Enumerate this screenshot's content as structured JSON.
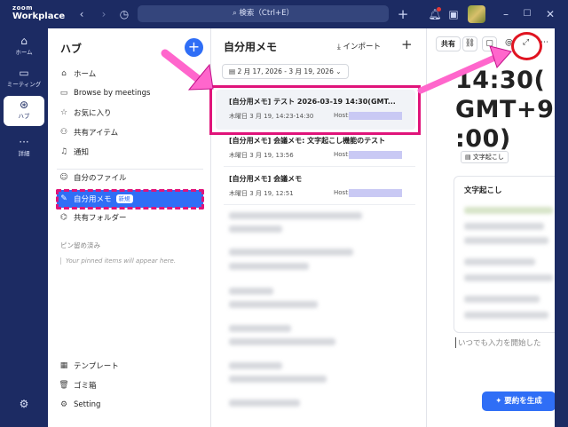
{
  "app": {
    "brand_top": "zoom",
    "brand_bottom": "Workplace"
  },
  "titlebar": {
    "search_placeholder": "検索（Ctrl+E）"
  },
  "rail": {
    "items": [
      {
        "label": "ホーム",
        "icon": "home-icon"
      },
      {
        "label": "ミーティング",
        "icon": "video-icon"
      },
      {
        "label": "ハブ",
        "icon": "hub-icon"
      },
      {
        "label": "詳細",
        "icon": "more-icon"
      }
    ]
  },
  "hub": {
    "title": "ハブ",
    "nav": [
      {
        "label": "ホーム",
        "icon": "home-icon"
      },
      {
        "label": "Browse by meetings",
        "icon": "video-icon"
      },
      {
        "label": "お気に入り",
        "icon": "star-icon"
      },
      {
        "label": "共有アイテム",
        "icon": "people-icon"
      },
      {
        "label": "通知",
        "icon": "bell-icon"
      },
      {
        "label": "自分のファイル",
        "icon": "user-icon"
      },
      {
        "label": "自分用メモ",
        "icon": "pen-icon",
        "badge": "新規"
      },
      {
        "label": "共有フォルダー",
        "icon": "folder-icon"
      }
    ],
    "pinned_title": "ピン留め済み",
    "pinned_empty": "Your pinned items will appear here.",
    "bottom": [
      {
        "label": "テンプレート",
        "icon": "grid-icon"
      },
      {
        "label": "ゴミ箱",
        "icon": "trash-icon"
      },
      {
        "label": "Setting",
        "icon": "gear-icon"
      }
    ]
  },
  "notes": {
    "title": "自分用メモ",
    "import_label": "インポート",
    "date_range": "2 月 17, 2026 - 3 月 19, 2026",
    "host_label": "Host:",
    "items": [
      {
        "title": "[自分用メモ] テスト 2026-03-19 14:30(GMT...",
        "meta": "木曜日 3 月 19, 14:23-14:30"
      },
      {
        "title": "[自分用メモ] 会議メモ: 文字起こし機能のテスト",
        "meta": "木曜日 3 月 19, 13:56"
      },
      {
        "title": "[自分用メモ] 会議メモ",
        "meta": "木曜日 3 月 19, 12:51"
      }
    ]
  },
  "right": {
    "share_label": "共有",
    "doc_title": "14:30(GMT+9:00)",
    "doc_title_lines": [
      "14:30(",
      "GMT+9",
      ":00)"
    ],
    "transcript_chip": "文字起こし",
    "transcript_title": "文字起こし",
    "placeholder": "いつでも入力を開始した",
    "summary_button": "要約を生成"
  },
  "colors": {
    "accent": "#2f6ef6",
    "nav_bg": "#1c2b63",
    "highlight": "#e0147a"
  }
}
